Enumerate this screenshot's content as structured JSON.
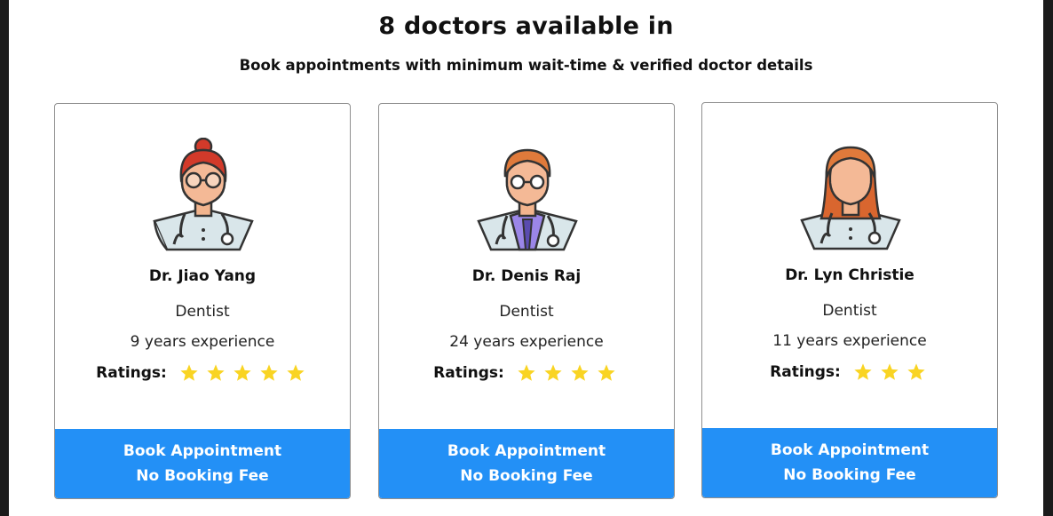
{
  "header": {
    "title": "8 doctors available in",
    "subtitle": "Book appointments with minimum wait-time & verified doctor details"
  },
  "colors": {
    "button_blue": "#2390f6",
    "star_yellow": "#f9d423"
  },
  "doctors": [
    {
      "name": "Dr. Jiao Yang",
      "specialty": "Dentist",
      "experience": "9 years experience",
      "ratings_label": "Ratings:",
      "rating": 5,
      "avatar": "female-doctor-red-hair-glasses-icon",
      "button_line1": "Book Appointment",
      "button_line2": "No Booking Fee"
    },
    {
      "name": "Dr. Denis Raj",
      "specialty": "Dentist",
      "experience": "24 years experience",
      "ratings_label": "Ratings:",
      "rating": 4,
      "avatar": "male-doctor-glasses-icon",
      "button_line1": "Book Appointment",
      "button_line2": "No Booking Fee"
    },
    {
      "name": "Dr. Lyn Christie",
      "specialty": "Dentist",
      "experience": "11 years experience",
      "ratings_label": "Ratings:",
      "rating": 3,
      "avatar": "female-doctor-icon",
      "button_line1": "Book Appointment",
      "button_line2": "No Booking Fee"
    }
  ]
}
